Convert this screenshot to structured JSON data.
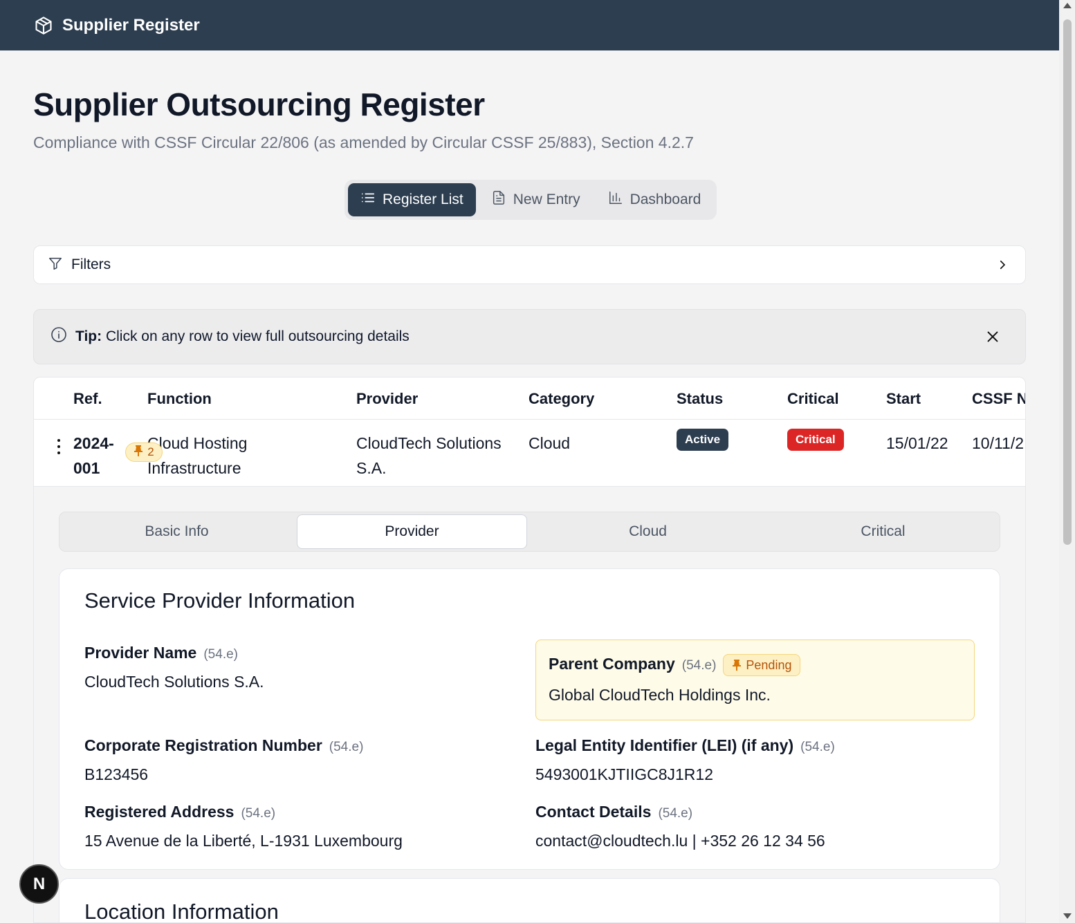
{
  "app": {
    "title": "Supplier Register",
    "logo_icon": "package-icon"
  },
  "page": {
    "title": "Supplier Outsourcing Register",
    "subtitle": "Compliance with CSSF Circular 22/806 (as amended by Circular CSSF 25/883), Section 4.2.7"
  },
  "nav_tabs": [
    {
      "label": "Register List",
      "icon": "list-icon",
      "active": true
    },
    {
      "label": "New Entry",
      "icon": "file-icon",
      "active": false
    },
    {
      "label": "Dashboard",
      "icon": "bar-chart-icon",
      "active": false
    }
  ],
  "filters": {
    "label": "Filters"
  },
  "tip": {
    "prefix": "Tip:",
    "text": " Click on any row to view full outsourcing details"
  },
  "table": {
    "headers": [
      "Ref.",
      "Function",
      "Provider",
      "Category",
      "Status",
      "Critical",
      "Start",
      "CSSF N"
    ],
    "rows": [
      {
        "ref_line1": "2024-",
        "ref_line2": "001",
        "pin_count": "2",
        "function_line1": "Cloud Hosting",
        "function_line2": "Infrastructure",
        "provider_line1": "CloudTech Solutions",
        "provider_line2": "S.A.",
        "category": "Cloud",
        "status": "Active",
        "critical": "Critical",
        "start": "15/01/22",
        "cssf_notified": "10/11/2"
      }
    ]
  },
  "detail": {
    "tabs": [
      "Basic Info",
      "Provider",
      "Cloud",
      "Critical"
    ],
    "active_tab": "Provider",
    "provider_card": {
      "title": "Service Provider Information",
      "fields": {
        "provider_name": {
          "label": "Provider Name",
          "ref": "(54.e)",
          "value": "CloudTech Solutions S.A."
        },
        "parent_company": {
          "label": "Parent Company",
          "ref": "(54.e)",
          "badge": "Pending",
          "value": "Global CloudTech Holdings Inc."
        },
        "registration_number": {
          "label": "Corporate Registration Number",
          "ref": "(54.e)",
          "value": "B123456"
        },
        "lei": {
          "label": "Legal Entity Identifier (LEI) (if any)",
          "ref": "(54.e)",
          "value": "5493001KJTIIGC8J1R12"
        },
        "address": {
          "label": "Registered Address",
          "ref": "(54.e)",
          "value": "15 Avenue de la Liberté, L-1931 Luxembourg"
        },
        "contact": {
          "label": "Contact Details",
          "ref": "(54.e)",
          "value": "contact@cloudtech.lu | +352 26 12 34 56"
        }
      }
    },
    "location_card": {
      "title": "Location Information"
    }
  },
  "colors": {
    "header_bg": "#2d3e50",
    "critical": "#dc2626",
    "pending_bg": "#fdf0c4",
    "pending_text": "#b45309"
  },
  "floating": {
    "label": "N"
  }
}
